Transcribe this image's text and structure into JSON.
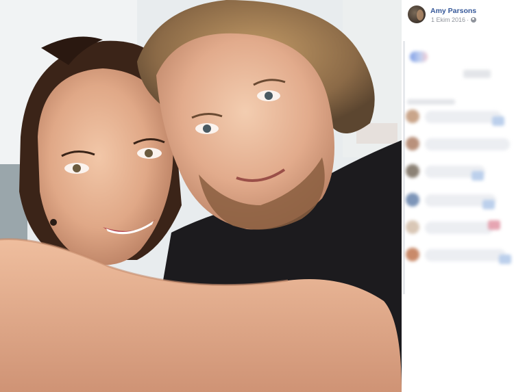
{
  "post": {
    "author_name": "Amy Parsons",
    "date": "1 Ekim 2016",
    "separator": "·",
    "privacy_icon": "globe-icon"
  },
  "colors": {
    "author_link": "#365899",
    "meta_text": "#90949c"
  }
}
